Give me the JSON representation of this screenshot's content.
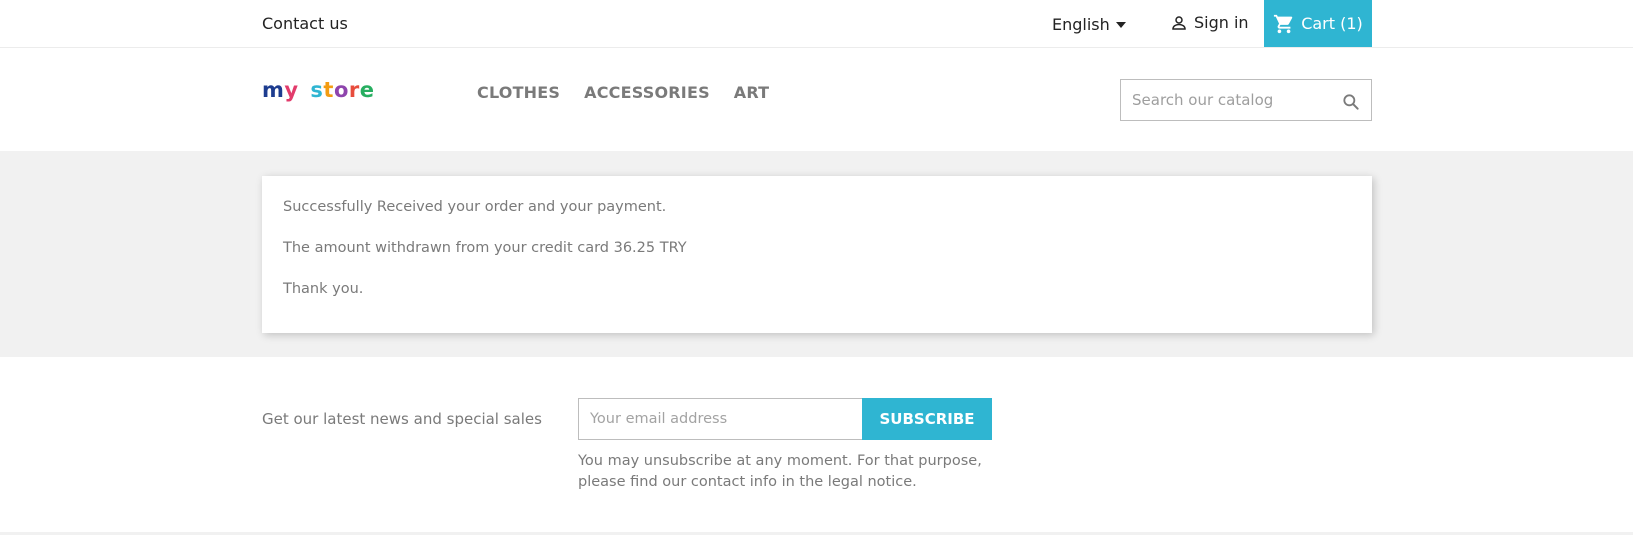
{
  "topnav": {
    "contact": "Contact us",
    "language": "English",
    "signin": "Sign in",
    "cart": "Cart (1)"
  },
  "header": {
    "logo_text": "my store",
    "menu": [
      "CLOTHES",
      "ACCESSORIES",
      "ART"
    ],
    "search_placeholder": "Search our catalog"
  },
  "confirmation": {
    "line1": "Successfully Received your order and your payment.",
    "line2": "The amount withdrawn from your credit card 36.25 TRY",
    "line3": "Thank you."
  },
  "newsletter": {
    "label": "Get our latest news and special sales",
    "email_placeholder": "Your email address",
    "button": "SUBSCRIBE",
    "note": "You may unsubscribe at any moment. For that purpose, please find our contact info in the legal notice."
  },
  "colors": {
    "accent": "#2fb5d2",
    "background_gray": "#f1f1f1",
    "text_muted": "#7a7a7a"
  },
  "icons": {
    "signin": "person-icon",
    "cart": "shopping-cart-icon",
    "search": "search-icon",
    "language": "caret-down-icon"
  }
}
